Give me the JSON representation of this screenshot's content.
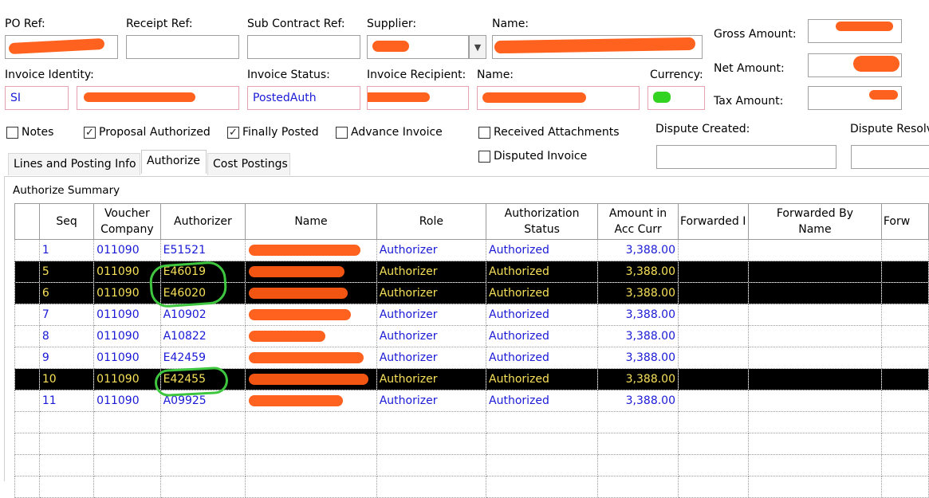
{
  "header": {
    "po_ref_label": "PO Ref:",
    "receipt_ref_label": "Receipt Ref:",
    "sub_contract_ref_label": "Sub Contract Ref:",
    "supplier_label": "Supplier:",
    "name_label": "Name:",
    "gross_amount_label": "Gross Amount:",
    "net_amount_label": "Net Amount:",
    "tax_amount_label": "Tax Amount:",
    "invoice_identity_label": "Invoice Identity:",
    "invoice_identity_value": "SI",
    "invoice_status_label": "Invoice Status:",
    "invoice_status_value": "PostedAuth",
    "invoice_recipient_label": "Invoice Recipient:",
    "recipient_name_label": "Name:",
    "currency_label": "Currency:",
    "dispute_created_label": "Dispute Created:",
    "dispute_resolved_label": "Dispute Resolv"
  },
  "checkboxes": {
    "notes": {
      "label": "Notes",
      "checked": false
    },
    "proposal_authorized": {
      "label": "Proposal Authorized",
      "checked": true
    },
    "finally_posted": {
      "label": "Finally Posted",
      "checked": true
    },
    "advance_invoice": {
      "label": "Advance Invoice",
      "checked": false
    },
    "received_attachments": {
      "label": "Received Attachments",
      "checked": false
    },
    "disputed_invoice": {
      "label": "Disputed Invoice",
      "checked": false
    }
  },
  "tabs": [
    {
      "label": "Lines and Posting Info",
      "active": false
    },
    {
      "label": "Authorize",
      "active": true
    },
    {
      "label": "Cost Postings",
      "active": false
    }
  ],
  "section_title": "Authorize Summary",
  "table": {
    "columns": [
      "",
      "Seq",
      "Voucher Company",
      "Authorizer",
      "Name",
      "Role",
      "Authorization Status",
      "Amount in Acc Curr",
      "Forwarded I",
      "Forwarded By Name",
      "Forw"
    ],
    "rows": [
      {
        "seq": "1",
        "company": "011090",
        "authorizer": "E51521",
        "role": "Authorizer",
        "status": "Authorized",
        "amount": "3,388.00",
        "selected": false
      },
      {
        "seq": "5",
        "company": "011090",
        "authorizer": "E46019",
        "role": "Authorizer",
        "status": "Authorized",
        "amount": "3,388.00",
        "selected": true
      },
      {
        "seq": "6",
        "company": "011090",
        "authorizer": "E46020",
        "role": "Authorizer",
        "status": "Authorized",
        "amount": "3,388.00",
        "selected": true
      },
      {
        "seq": "7",
        "company": "011090",
        "authorizer": "A10902",
        "role": "Authorizer",
        "status": "Authorized",
        "amount": "3,388.00",
        "selected": false
      },
      {
        "seq": "8",
        "company": "011090",
        "authorizer": "A10822",
        "role": "Authorizer",
        "status": "Authorized",
        "amount": "3,388.00",
        "selected": false
      },
      {
        "seq": "9",
        "company": "011090",
        "authorizer": "E42459",
        "role": "Authorizer",
        "status": "Authorized",
        "amount": "3,388.00",
        "selected": false
      },
      {
        "seq": "10",
        "company": "011090",
        "authorizer": "E42455",
        "role": "Authorizer",
        "status": "Authorized",
        "amount": "3,388.00",
        "selected": true
      },
      {
        "seq": "11",
        "company": "011090",
        "authorizer": "A09925",
        "role": "Authorizer",
        "status": "Authorized",
        "amount": "3,388.00",
        "selected": false
      }
    ]
  },
  "colors": {
    "redaction": "#ff5a12",
    "highlight_circle": "#3fc63f",
    "link_text": "#1a1ad6",
    "selected_row_bg": "#000000",
    "selected_row_text": "#f7e15a"
  }
}
